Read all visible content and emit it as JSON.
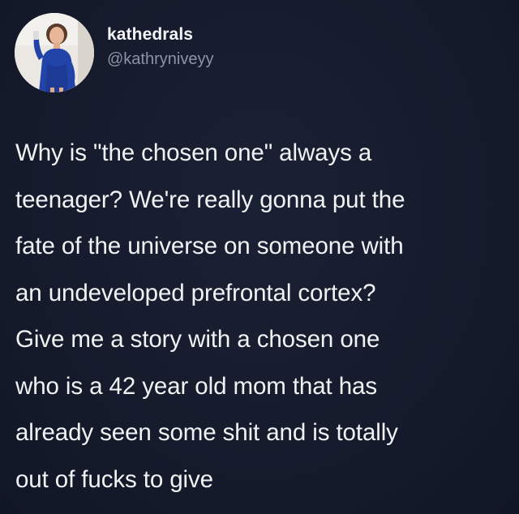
{
  "user": {
    "display_name": "kathedrals",
    "handle": "@kathryniveyy",
    "avatar": "profile-photo-icon"
  },
  "tweet": {
    "lines": [
      "Why is \"the chosen one\" always a",
      "teenager? We're really gonna put the",
      "fate of the universe on someone with",
      "an undeveloped prefrontal cortex?",
      "Give me a story with a chosen one",
      "who is a 42 year old mom that has",
      "already seen some shit and is totally",
      "out of fucks to give"
    ]
  },
  "colors": {
    "background": "#151a2b",
    "text": "#f1f2f4",
    "handle": "#8b94a6"
  }
}
